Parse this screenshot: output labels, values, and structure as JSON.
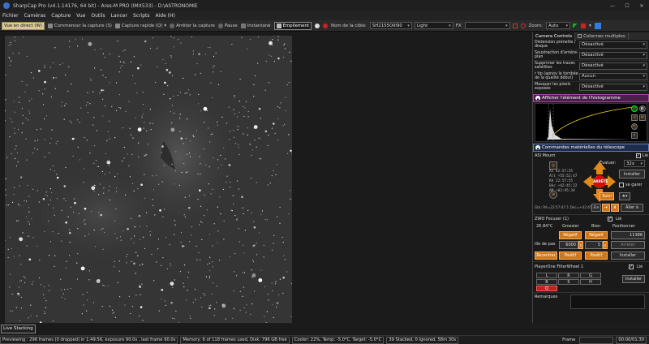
{
  "window": {
    "title": "SharpCap Pro (v4.1.14176, 64 bit) - Ares-M PRO (IMX533) - D:\\ASTRONOMIE"
  },
  "menu": [
    "Fichier",
    "Caméras",
    "Capture",
    "Vue",
    "Outils",
    "Lancer",
    "Scripts",
    "Aide (H)"
  ],
  "toolbar": {
    "live": "Vue en direct (W)",
    "start": "Commencer la capture (S)",
    "quick": "Capture rapide (Q)",
    "stop": "Arrêter la capture",
    "pause": "Pause",
    "snapshot": "Instantané",
    "stack": "Empilement",
    "target_label": "Nom de la cible:",
    "target_value": "SH2155OIII90",
    "frame_type": "Light",
    "fx_label": "FX",
    "zoom_label": "Zoom:",
    "zoom_value": "Auto"
  },
  "panel": {
    "tab1": "Camera Controls",
    "tab2": "Colonnes multiples",
    "rows": [
      {
        "label": "Distension prénette / disque",
        "value": "Désactivé"
      },
      {
        "label": "Soustraction d'arrière-plan",
        "value": "Désactivé"
      },
      {
        "label": "Supprimer les traces satellites",
        "value": "Désactivé"
      },
      {
        "label": "r tip (apnov le tombée de la qualité début)",
        "value": "Aucun"
      },
      {
        "label": "Masquer les pixels exposés",
        "value": "Désactivé"
      }
    ],
    "histo_title": "Afficher l'élément de l'histogramme",
    "hw_title": "Commandes matérielles du télescope",
    "mount": {
      "name": "ASI Mount",
      "evaluer": "Évaluer:",
      "rate": "32x",
      "install": "Installer",
      "stop": "ARRÊTE",
      "coords": [
        "Az   42:57:55",
        "Alt  +55:52:47",
        "RA   22:57:55",
        "Déc  +42:45:22",
        "AM   +03:45:34"
      ],
      "se_gare": "se garer",
      "suivi": "Suivi",
      "aller": "Aller à",
      "goto_line": "Gta: RA=22:57:47.1 Dec=+42:45:22",
      "lie": "Lié"
    },
    "focuser": {
      "name": "ZWO Focuser (1)",
      "lie": "Lié",
      "temp": "26.84°C",
      "grossier": "Grossier",
      "bien": "Bien",
      "positionner": "Positionner",
      "position": "11386",
      "negatif1": "Négatif",
      "negatif2": "Négatif",
      "taille_label": "ille de pas",
      "taille1": "6000",
      "taille2": "5",
      "arreter": "Arrêter",
      "recentrer": "Recentrer",
      "positif1": "Positif",
      "positif2": "Positif",
      "installer": "Installer"
    },
    "filterwheel": {
      "name": "PlayerOne FilterWheel 1",
      "lie": "Lié",
      "filters": [
        "L",
        "R",
        "G",
        "B",
        "S",
        "H",
        "O"
      ],
      "installer": "Installer"
    },
    "remarques": "Remarques"
  },
  "livestacking": "Live Stacking",
  "status": {
    "preview": "Previewing : 296 frames (0 dropped) in 1:49:56, exposure 90.0s , last frame 90.0s",
    "memory": "Memory: 6 of 118 frames used, Disk: 796 GB free",
    "cooler": "Cooler: 22%, Temp: -5.0°C, Target: -5.0°C",
    "stacked": "39 Stacked, 0 Ignored, 58m 30s",
    "frame_label": "Frame",
    "time": "00:00/01:30"
  }
}
